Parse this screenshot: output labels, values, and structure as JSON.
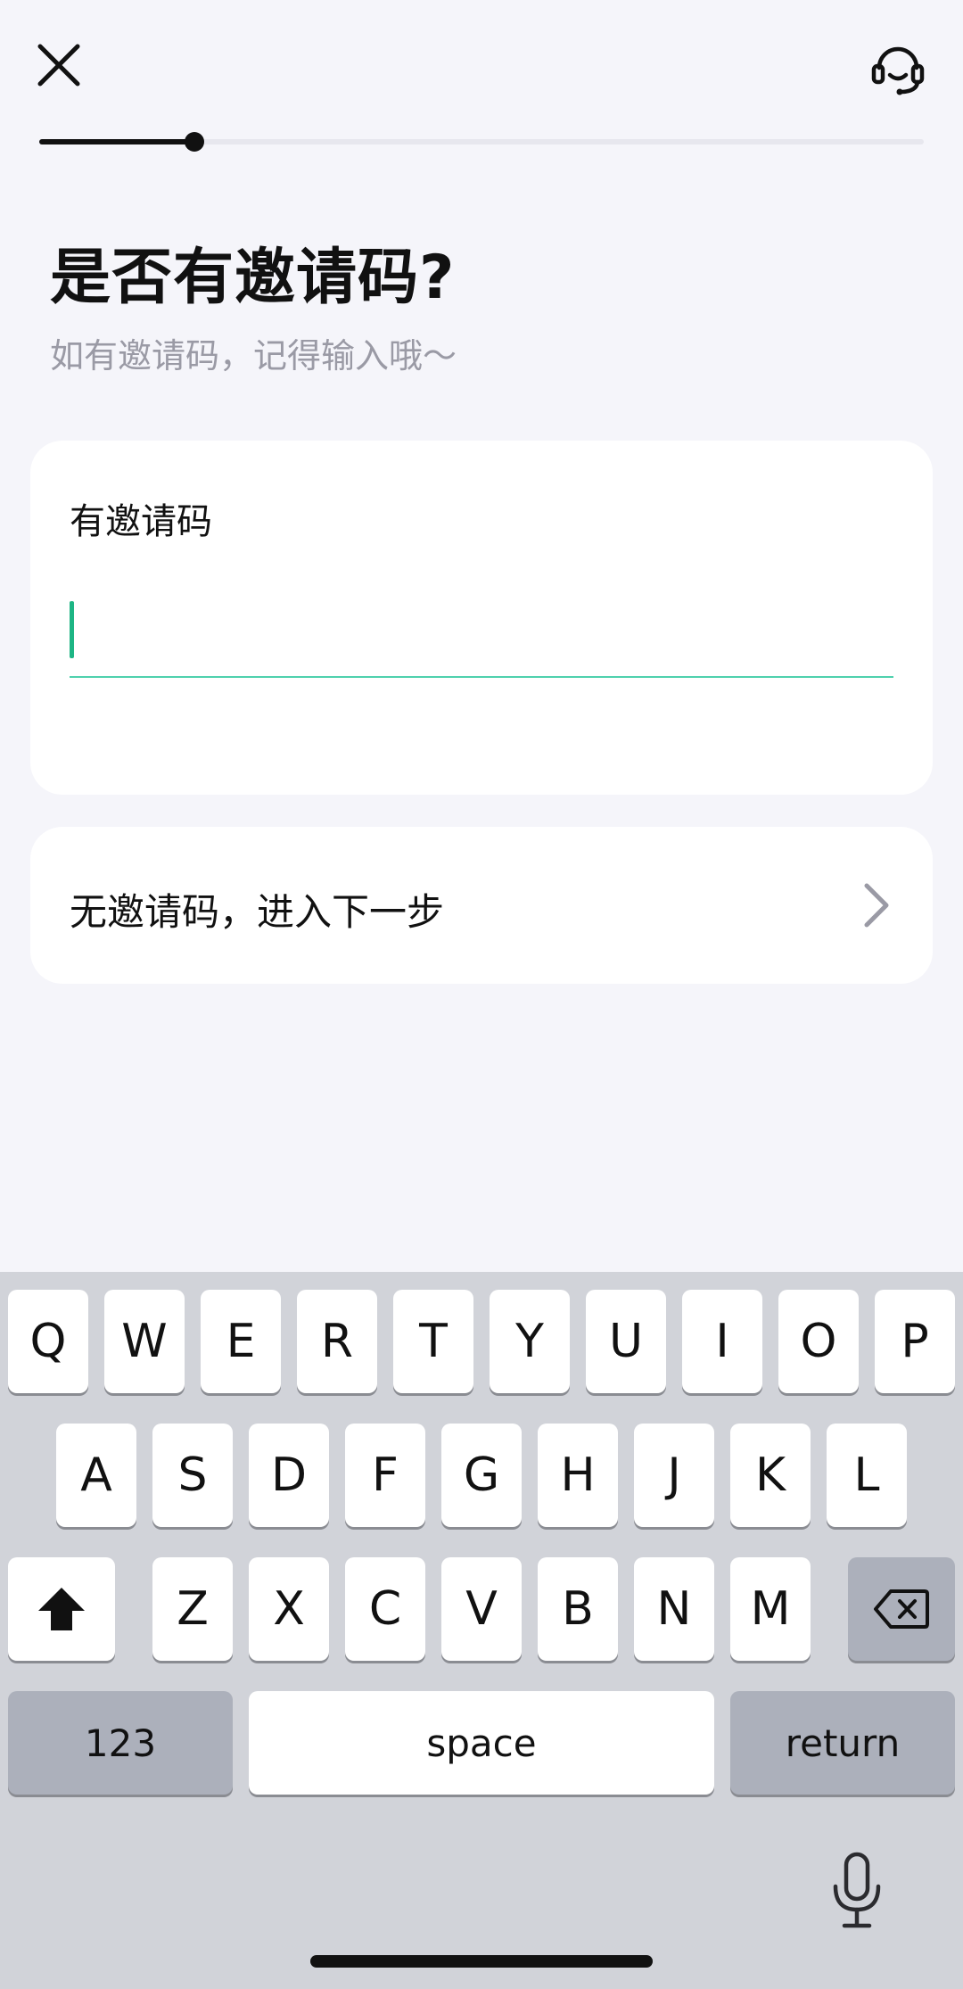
{
  "header": {
    "close_icon": "close-icon",
    "support_icon": "headset-icon"
  },
  "progress": {
    "value": 0.175
  },
  "title": "是否有邀请码?",
  "subtitle": "如有邀请码，记得输入哦～",
  "invite_card": {
    "label": "有邀请码",
    "input_value": "",
    "input_placeholder": ""
  },
  "skip_card": {
    "label": "无邀请码，进入下一步",
    "chevron_icon": "chevron-right-icon"
  },
  "keyboard": {
    "row1": [
      "Q",
      "W",
      "E",
      "R",
      "T",
      "Y",
      "U",
      "I",
      "O",
      "P"
    ],
    "row2": [
      "A",
      "S",
      "D",
      "F",
      "G",
      "H",
      "J",
      "K",
      "L"
    ],
    "row3": [
      "Z",
      "X",
      "C",
      "V",
      "B",
      "N",
      "M"
    ],
    "shift_icon": "shift-icon",
    "delete_icon": "backspace-icon",
    "numbers_label": "123",
    "space_label": "space",
    "return_label": "return",
    "mic_icon": "microphone-icon"
  },
  "colors": {
    "accent": "#1db584",
    "underline": "#4fd1ad",
    "background": "#f5f5fa"
  }
}
